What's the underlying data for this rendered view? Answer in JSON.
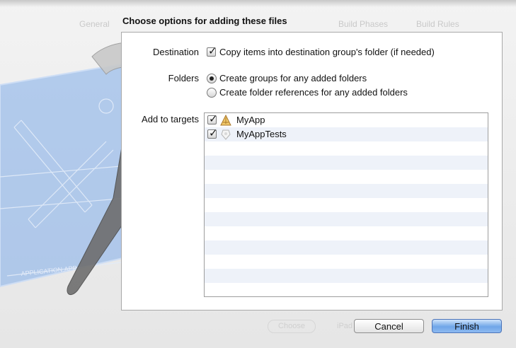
{
  "background": {
    "tabs": [
      "General",
      "Build Phases",
      "Build Rules"
    ],
    "bottom_button_label": "Choose",
    "bottom_text": "iPad"
  },
  "dialog": {
    "title": "Choose options for adding these files",
    "destination": {
      "label": "Destination",
      "checkbox_label": "Copy items into destination group's folder (if needed)",
      "checked": true
    },
    "folders": {
      "label": "Folders",
      "options": [
        {
          "label": "Create groups for any added folders",
          "selected": true
        },
        {
          "label": "Create folder references for any added folders",
          "selected": false
        }
      ]
    },
    "targets": {
      "label": "Add to targets",
      "items": [
        {
          "label": "MyApp",
          "checked": true,
          "icon": "app-target-icon"
        },
        {
          "label": "MyAppTests",
          "checked": true,
          "icon": "test-bundle-icon"
        }
      ]
    },
    "buttons": {
      "cancel": "Cancel",
      "finish": "Finish"
    }
  },
  "colors": {
    "list_stripe": "#eef2f9",
    "finish_button": "#6fa6e8",
    "blueprint": "#5b8fd9"
  }
}
